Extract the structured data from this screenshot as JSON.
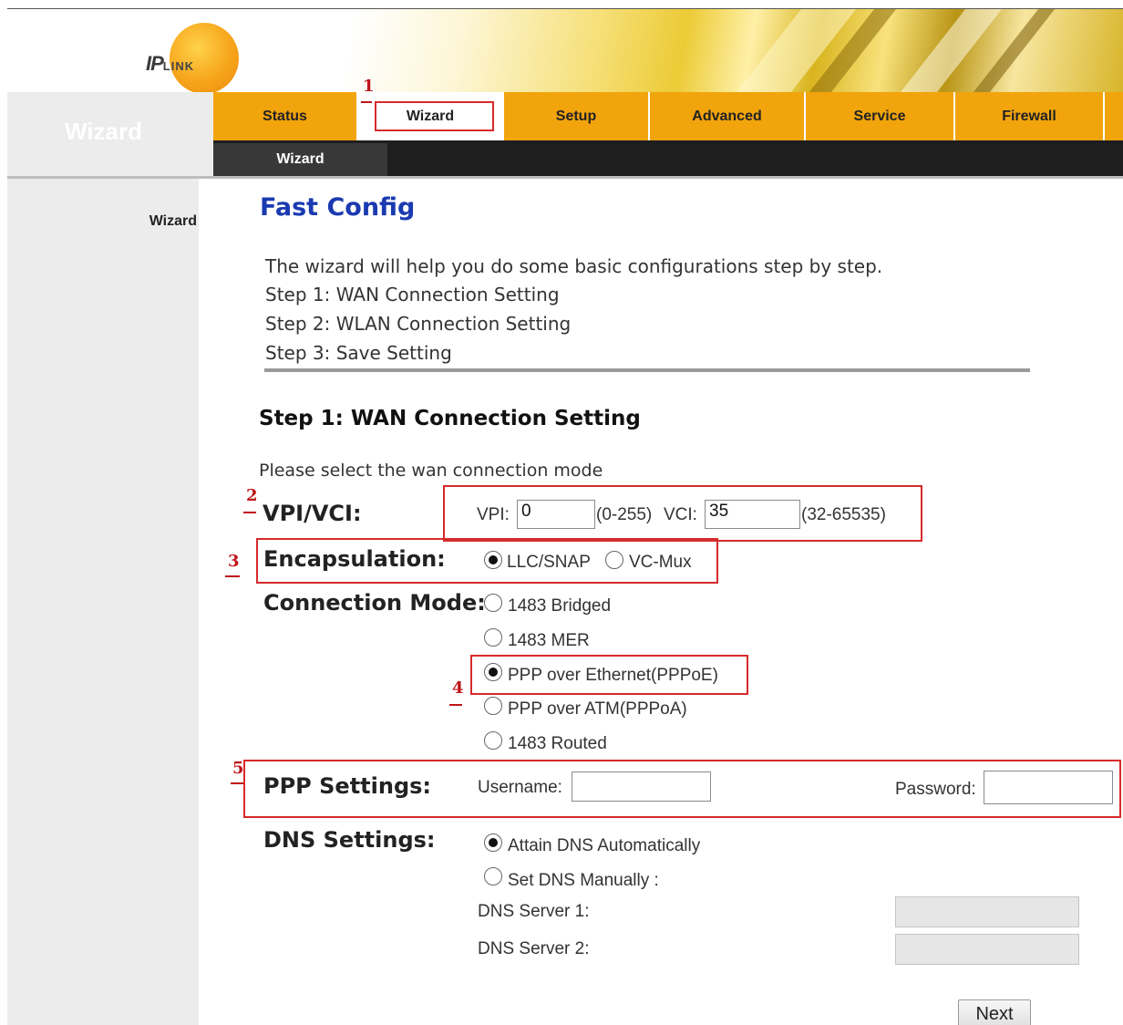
{
  "brand": {
    "logo_main": "IP",
    "logo_sub": "LINK"
  },
  "sidebar": {
    "header": "Wizard",
    "items": [
      {
        "label": "Wizard"
      }
    ]
  },
  "nav": {
    "tabs": [
      {
        "label": "Status"
      },
      {
        "label": "Wizard",
        "active": true
      },
      {
        "label": "Setup"
      },
      {
        "label": "Advanced"
      },
      {
        "label": "Service"
      },
      {
        "label": "Firewall"
      }
    ],
    "subtab": "Wizard"
  },
  "main": {
    "title": "Fast Config",
    "intro": [
      "The wizard will help you do some basic configurations step by step.",
      "Step 1: WAN Connection Setting",
      "Step 2: WLAN Connection Setting",
      "Step 3: Save Setting"
    ],
    "section_title": "Step 1: WAN Connection Setting",
    "prompt": "Please select the wan connection mode",
    "vpivci": {
      "label": "VPI/VCI:",
      "vpi_label": "VPI:",
      "vpi_value": "0",
      "vpi_range": "(0-255)",
      "vci_label": "VCI:",
      "vci_value": "35",
      "vci_range": "(32-65535)"
    },
    "encapsulation": {
      "label": "Encapsulation:",
      "options": [
        {
          "label": "LLC/SNAP",
          "selected": true
        },
        {
          "label": "VC-Mux",
          "selected": false
        }
      ]
    },
    "connection_mode": {
      "label": "Connection Mode:",
      "options": [
        {
          "label": "1483 Bridged",
          "selected": false
        },
        {
          "label": "1483 MER",
          "selected": false
        },
        {
          "label": "PPP over Ethernet(PPPoE)",
          "selected": true
        },
        {
          "label": "PPP over ATM(PPPoA)",
          "selected": false
        },
        {
          "label": "1483 Routed",
          "selected": false
        }
      ]
    },
    "ppp": {
      "label": "PPP Settings:",
      "username_label": "Username:",
      "username_value": "",
      "password_label": "Password:",
      "password_value": ""
    },
    "dns": {
      "label": "DNS Settings:",
      "options": [
        {
          "label": "Attain DNS Automatically",
          "selected": true
        },
        {
          "label": "Set DNS Manually :",
          "selected": false
        }
      ],
      "server1_label": "DNS Server 1:",
      "server1_value": "",
      "server2_label": "DNS Server 2:",
      "server2_value": ""
    },
    "next_label": "Next"
  },
  "annotations": {
    "marks": [
      "1",
      "2",
      "3",
      "4",
      "5"
    ],
    "color": "#c0141a"
  },
  "colors": {
    "tab_bg": "#f2a40c",
    "title_blue": "#1a3ab0",
    "subbar": "#1e1e1e"
  }
}
